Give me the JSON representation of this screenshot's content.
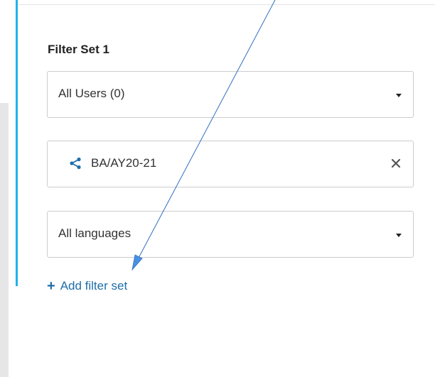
{
  "panel": {
    "filter_set_title": "Filter Set 1",
    "users_select": {
      "value": "All Users (0)"
    },
    "cohort_chip": {
      "label": "BA/AY20-21"
    },
    "language_select": {
      "value": "All languages"
    },
    "add_filter_set_label": "Add filter set"
  },
  "icons": {
    "cohort": "share-icon",
    "clear": "close-icon",
    "dropdown": "caret-down-icon",
    "add": "plus-icon"
  },
  "colors": {
    "accent_bar": "#1fb2ea",
    "link": "#1f6ea8",
    "annotation_arrow": "#2f6fbf"
  }
}
